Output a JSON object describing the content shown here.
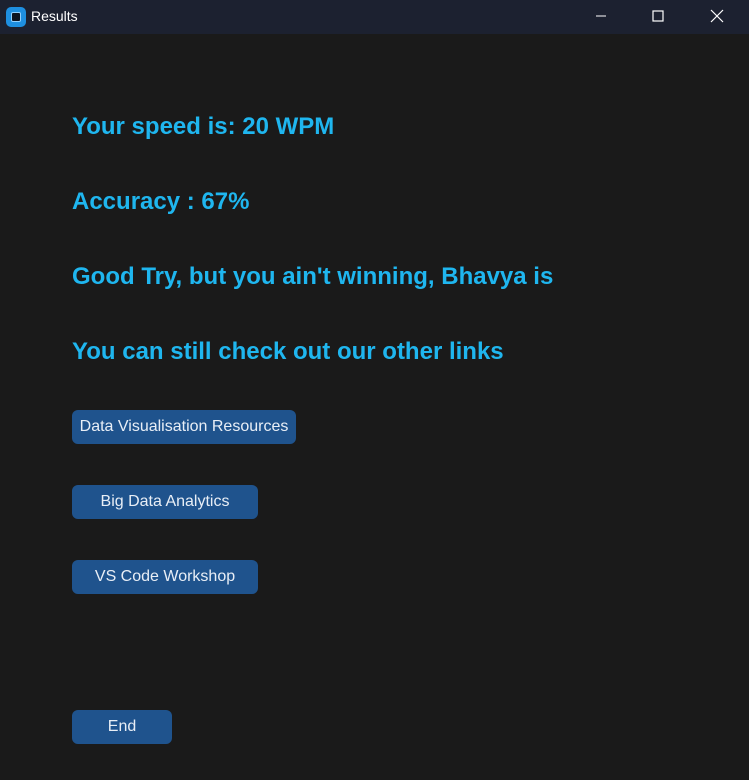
{
  "window": {
    "title": "Results"
  },
  "icons": {
    "app": "app-icon",
    "minimize": "minimize-icon",
    "maximize": "maximize-icon",
    "close": "close-icon"
  },
  "colors": {
    "background": "#1a1a1a",
    "titlebar": "#1c2130",
    "accent_text": "#1fb6ef",
    "button": "#1f538d",
    "button_text": "#e8eef6"
  },
  "results": {
    "speed": "Your speed is: 20 WPM",
    "accuracy": "Accuracy : 67%",
    "message": "Good Try, but you ain't winning, Bhavya is",
    "links_prompt": "You can still check out our other links"
  },
  "links": {
    "data_visualisation": "Data Visualisation Resources",
    "big_data": "Big Data Analytics",
    "vs_code": "VS Code Workshop"
  },
  "actions": {
    "end": "End"
  }
}
